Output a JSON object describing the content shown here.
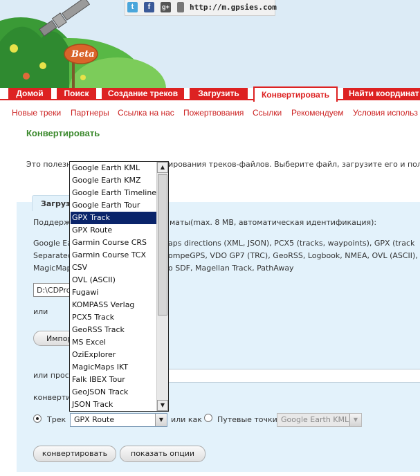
{
  "share": {
    "url": "http://m.gpsies.com",
    "icons": [
      "twitter-icon",
      "facebook-icon",
      "google-plus-icon",
      "mobile-icon"
    ]
  },
  "header": {
    "badge": "Beta"
  },
  "main_nav": [
    "Домой",
    "Поиск",
    "Создание треков",
    "Загрузить",
    "Конвертировать",
    "Найти координат"
  ],
  "sub_nav": [
    "Новые треки",
    "Партнеры",
    "Ссылка на нас",
    "Пожертвования",
    "Ссылки",
    "Рекомендуем",
    "Условия использ"
  ],
  "page": {
    "title": "Конвертировать",
    "intro_left": "Это полезн",
    "intro_right": "ирования треков-файлов. Выберите файл, загрузите его и полу-"
  },
  "panel": {
    "tab_label": "Загруз",
    "supported_left": "Поддерж",
    "supported_right": "маты(max. 8 MB, автоматическая идентификация):",
    "formats_line1_left": "Google Ea",
    "formats_line1_right": "aps directions (XML, JSON), PCX5 (tracks, waypoints), GPX (track",
    "formats_line2_left": "Separated",
    "formats_line2_right": "ompeGPS, VDO GP7 (TRC), GeoRSS, Logbook, NMEA, OVL (ASCII), F",
    "formats_line3_left": "MagicMap",
    "formats_line3_right": "o SDF, Magellan Track, PathAway",
    "file_value": "D:\\CDPro",
    "or_label": "или",
    "import_button": "Импор",
    "or_url_label": "или прос",
    "convert_label": "конверти",
    "track_label": "Трек",
    "track_select_value": "GPX Route",
    "or_as_label": "или как",
    "waypoints_label": "Путевые точки",
    "waypoints_select_value": "Google Earth KML",
    "convert_button": "конвертировать",
    "options_button": "показать опции"
  },
  "dropdown": {
    "selected": "GPX Track",
    "options": [
      "Google Earth KML",
      "Google Earth KMZ",
      "Google Earth Timeline",
      "Google Earth Tour",
      "GPX Track",
      "GPX Route",
      "Garmin Course CRS",
      "Garmin Course TCX",
      "CSV",
      "OVL (ASCII)",
      "Fugawi",
      "KOMPASS Verlag",
      "PCX5 Track",
      "GeoRSS Track",
      "MS Excel",
      "OziExplorer",
      "MagicMaps IKT",
      "Falk IBEX Tour",
      "GeoJSON Track",
      "JSON Track"
    ]
  },
  "colors": {
    "nav_red": "#d22222",
    "title_green": "#3c8a2e",
    "panel_bg": "#e3f2fb",
    "selection": "#0a246a"
  }
}
